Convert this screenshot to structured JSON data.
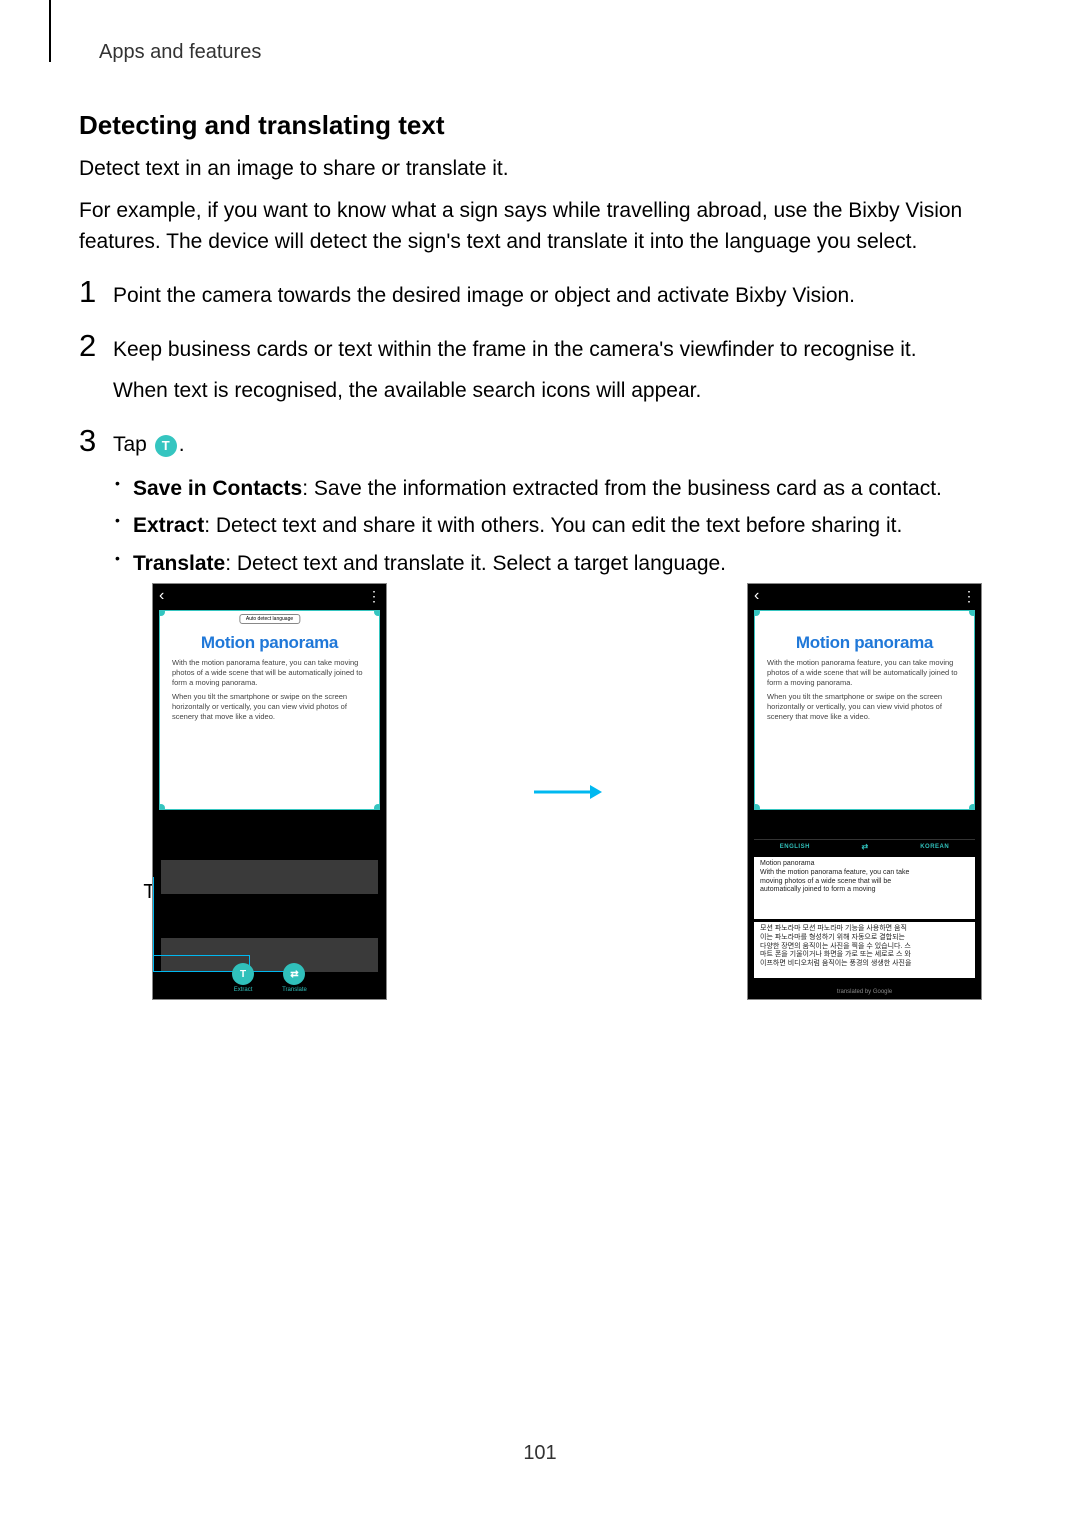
{
  "header": {
    "section": "Apps and features"
  },
  "title": "Detecting and translating text",
  "intro1": "Detect text in an image to share or translate it.",
  "intro2": "For example, if you want to know what a sign says while travelling abroad, use the Bixby Vision features. The device will detect the sign's text and translate it into the language you select.",
  "steps": {
    "s1": {
      "num": "1",
      "text": "Point the camera towards the desired image or object and activate Bixby Vision."
    },
    "s2": {
      "num": "2",
      "line1": "Keep business cards or text within the frame in the camera's viewfinder to recognise it.",
      "line2": "When text is recognised, the available search icons will appear."
    },
    "s3": {
      "num": "3",
      "prefix": "Tap ",
      "icon_letter": "T",
      "suffix": ".",
      "bullets": {
        "b1_label": "Save in Contacts",
        "b1_text": ": Save the information extracted from the business card as a contact.",
        "b2_label": "Extract",
        "b2_text": ": Detect text and share it with others. You can edit the text before sharing it.",
        "b3_label": "Translate",
        "b3_text": ": Detect text and translate it. Select a target language."
      }
    }
  },
  "callouts": {
    "translate": "Translate",
    "extract": "Extract"
  },
  "phones": {
    "auto_lang": "Auto detect language",
    "mp_title": "Motion panorama",
    "mp_para1": "With the motion panorama feature, you can take moving photos of a wide scene that will be automatically joined to form a moving panorama.",
    "mp_para2": "When you tilt the smartphone or swipe on the screen horizontally or vertically, you can view vivid photos of scenery that move like a video.",
    "buttons": {
      "extract": "Extract",
      "translate": "Translate",
      "extract_letter": "T",
      "translate_letter": "⇄"
    },
    "lang": {
      "left": "ENGLISH",
      "right": "KOREAN",
      "swap": "⇄"
    },
    "eng_block": "Motion panorama\nWith the motion panorama feature, you can take\nmoving photos of a wide scene that will be\nautomatically joined to form a moving",
    "kor_block": "모션 파노라마 모션 파노라마 기능을 사용하면 움직\n이는 파노라마를 형성하기 위해 자동으로 결합되는\n다양한 장면의 움직이는 사진을 찍을 수 있습니다. 스\n마트 폰을 기울이거나 화면을 가로 또는 세로로 스 와\n이프하면 비디오처럼 움직이는 풍경의 생생한 사진을",
    "translated_by": "translated by Google"
  },
  "page_number": "101"
}
